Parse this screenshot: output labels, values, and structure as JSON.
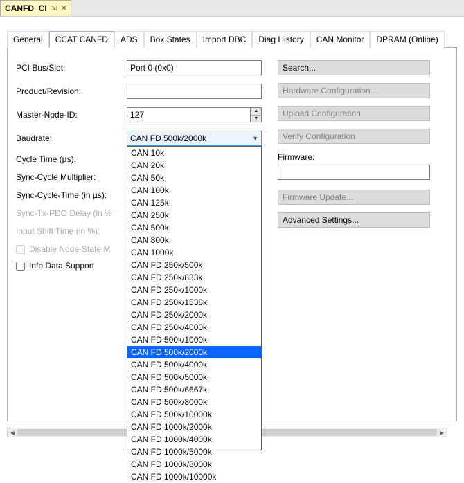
{
  "window": {
    "title": "CANFD_CI"
  },
  "tabs": [
    "General",
    "CCAT CANFD",
    "ADS",
    "Box States",
    "Import DBC",
    "Diag History",
    "CAN Monitor",
    "DPRAM (Online)"
  ],
  "active_tab": 1,
  "form": {
    "pci_bus_slot": {
      "label": "PCI Bus/Slot:",
      "value": "Port 0 (0x0)"
    },
    "product_revision": {
      "label": "Product/Revision:",
      "value": ""
    },
    "master_node_id": {
      "label": "Master-Node-ID:",
      "value": "127"
    },
    "baudrate": {
      "label": "Baudrate:",
      "value": "CAN FD 500k/2000k"
    },
    "cycle_time": {
      "label": "Cycle Time (µs):"
    },
    "sync_cycle_multiplier": {
      "label": "Sync-Cycle Multiplier:"
    },
    "sync_cycle_time": {
      "label": "Sync-Cycle-Time (in µs):"
    },
    "sync_tx_pdo_delay": {
      "label": "Sync-Tx-PDO Delay (in %"
    },
    "input_shift_time": {
      "label": "Input Shift Time (in %):"
    },
    "disable_node_state": {
      "label": "Disable Node-State M"
    },
    "info_data_support": {
      "label": "Info Data Support"
    }
  },
  "baudrate_options": [
    "CAN 10k",
    "CAN 20k",
    "CAN 50k",
    "CAN 100k",
    "CAN 125k",
    "CAN 250k",
    "CAN 500k",
    "CAN 800k",
    "CAN 1000k",
    "CAN FD 250k/500k",
    "CAN FD 250k/833k",
    "CAN FD 250k/1000k",
    "CAN FD 250k/1538k",
    "CAN FD 250k/2000k",
    "CAN FD 250k/4000k",
    "CAN FD 500k/1000k",
    "CAN FD 500k/2000k",
    "CAN FD 500k/4000k",
    "CAN FD 500k/5000k",
    "CAN FD 500k/6667k",
    "CAN FD 500k/8000k",
    "CAN FD 500k/10000k",
    "CAN FD 1000k/2000k",
    "CAN FD 1000k/4000k",
    "CAN FD 1000k/5000k",
    "CAN FD 1000k/8000k",
    "CAN FD 1000k/10000k"
  ],
  "baudrate_selected_index": 16,
  "right": {
    "search": "Search...",
    "hw_config": "Hardware Configuration...",
    "upload_config": "Upload Configuration",
    "verify_config": "Verify Configuration",
    "firmware_label": "Firmware:",
    "firmware_value": "",
    "firmware_update": "Firmware Update...",
    "advanced": "Advanced Settings..."
  }
}
